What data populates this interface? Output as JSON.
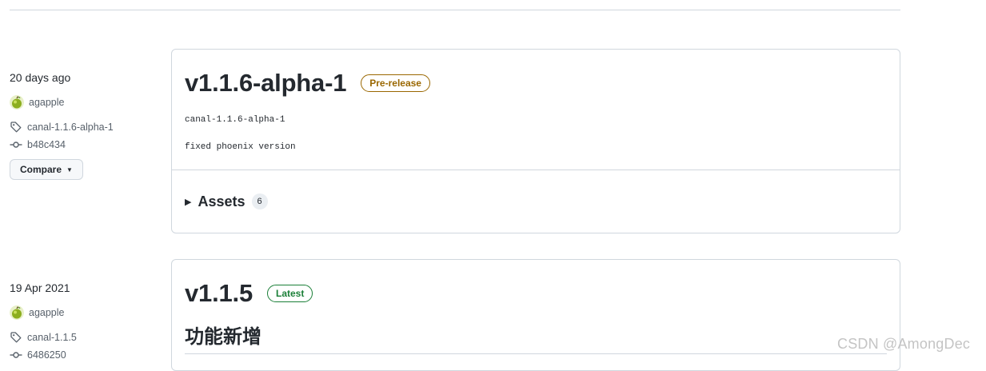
{
  "releases": [
    {
      "date": "20 days ago",
      "author": "agapple",
      "tag": "canal-1.1.6-alpha-1",
      "commit": "b48c434",
      "compare_label": "Compare",
      "title": "v1.1.6-alpha-1",
      "badge": "Pre-release",
      "body_lines": [
        "canal-1.1.6-alpha-1",
        "fixed phoenix version"
      ],
      "assets_label": "Assets",
      "assets_count": "6"
    },
    {
      "date": "19 Apr 2021",
      "author": "agapple",
      "tag": "canal-1.1.5",
      "commit": "6486250",
      "title": "v1.1.5",
      "badge": "Latest",
      "section_heading": "功能新增"
    }
  ],
  "watermark": "CSDN @AmongDec",
  "colors": {
    "prerelease": "#9a6700",
    "latest": "#1a7f37",
    "border": "#d0d7de"
  }
}
